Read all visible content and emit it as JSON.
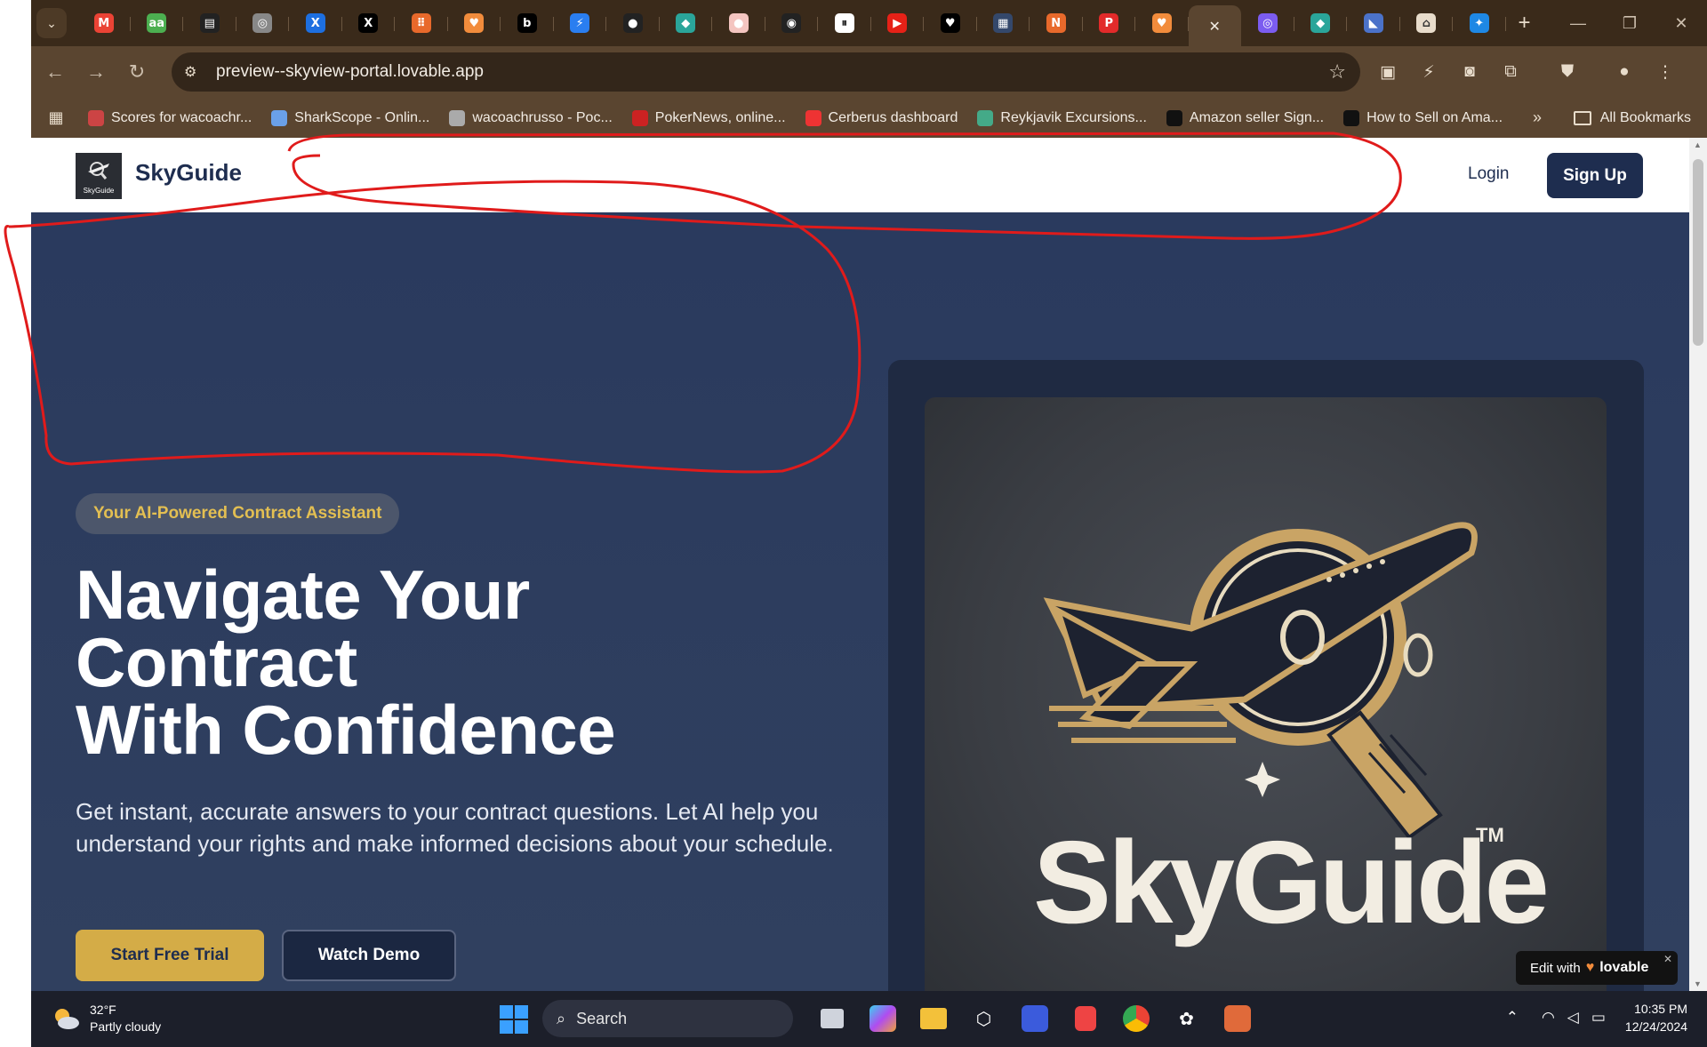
{
  "browser": {
    "tabs": [
      {
        "name": "gmail",
        "glyph": "M",
        "color": "#ea4335"
      },
      {
        "name": "aa",
        "glyph": "aa",
        "color": "#4caf50"
      },
      {
        "name": "app",
        "glyph": "▤",
        "color": "#222"
      },
      {
        "name": "globe",
        "glyph": "◎",
        "color": "#888"
      },
      {
        "name": "x-blue",
        "glyph": "X",
        "color": "#1d6fe0"
      },
      {
        "name": "x",
        "glyph": "X",
        "color": "#000"
      },
      {
        "name": "orange",
        "glyph": "⠿",
        "color": "#e8692b"
      },
      {
        "name": "lovable",
        "glyph": "♥",
        "color": "#f28c3c"
      },
      {
        "name": "b",
        "glyph": "b",
        "color": "#000"
      },
      {
        "name": "bolt",
        "glyph": "⚡",
        "color": "#2a7ef0"
      },
      {
        "name": "github",
        "glyph": "●",
        "color": "#222"
      },
      {
        "name": "diamond",
        "glyph": "◆",
        "color": "#2aa59a"
      },
      {
        "name": "dot",
        "glyph": "●",
        "color": "#f4c5c0"
      },
      {
        "name": "ring",
        "glyph": "◉",
        "color": "#222"
      },
      {
        "name": "pause",
        "glyph": "⏸",
        "color": "#fff"
      },
      {
        "name": "youtube",
        "glyph": "▶",
        "color": "#e62117"
      },
      {
        "name": "heart",
        "glyph": "♥",
        "color": "#000"
      },
      {
        "name": "ccs",
        "glyph": "▦",
        "color": "#34486b"
      },
      {
        "name": "orange-n",
        "glyph": "N",
        "color": "#e8692b"
      },
      {
        "name": "pinterest",
        "glyph": "P",
        "color": "#e22a2a"
      },
      {
        "name": "lovable2",
        "glyph": "♥",
        "color": "#f28c3c"
      },
      {
        "name": "close-active",
        "glyph": "✕",
        "color": "#5a4530"
      },
      {
        "name": "purple",
        "glyph": "◎",
        "color": "#7b5cf0"
      },
      {
        "name": "diamond2",
        "glyph": "◆",
        "color": "#2aa59a"
      },
      {
        "name": "blue-shape",
        "glyph": "◣",
        "color": "#4b72c9"
      },
      {
        "name": "home",
        "glyph": "⌂",
        "color": "#e8dccb"
      },
      {
        "name": "butterfly",
        "glyph": "✦",
        "color": "#1e88e5"
      }
    ],
    "address": "preview--skyview-portal.lovable.app",
    "bookmarks": [
      {
        "label": "Scores for wacoachr...",
        "color": "#c44"
      },
      {
        "label": "SharkScope - Onlin...",
        "color": "#6aa0e8"
      },
      {
        "label": "wacoachrusso - Poc...",
        "color": "#aaa"
      },
      {
        "label": "PokerNews, online...",
        "color": "#c22"
      },
      {
        "label": "Cerberus dashboard",
        "color": "#e33"
      },
      {
        "label": "Reykjavik Excursions...",
        "color": "#4a8"
      },
      {
        "label": "Amazon seller  Sign...",
        "color": "#111"
      },
      {
        "label": "How to Sell on Ama...",
        "color": "#111"
      }
    ],
    "all_bookmarks": "All Bookmarks"
  },
  "site": {
    "brand": "SkyGuide",
    "logo_caption": "SkyGuide",
    "login": "Login",
    "signup": "Sign Up",
    "badge": "Your AI-Powered Contract Assistant",
    "headline": [
      "Navigate Your",
      "Contract",
      "With Confidence"
    ],
    "subtext": "Get instant, accurate answers to your contract questions. Let AI help you understand your rights and make informed decisions about your schedule.",
    "cta_primary": "Start Free Trial",
    "cta_secondary": "Watch Demo",
    "hero_logo_word": "SkyGuide",
    "hero_logo_tm": "TM",
    "edit_with": "Edit with",
    "lovable": "lovable"
  },
  "taskbar": {
    "temp": "32°F",
    "weather": "Partly cloudy",
    "search": "Search",
    "time": "10:35 PM",
    "date": "12/24/2024"
  },
  "colors": {
    "navy": "#1e2d4f",
    "gold": "#d4ac47",
    "hero_bg": "#2c3b5e",
    "annotation_red": "#e01b1b"
  }
}
